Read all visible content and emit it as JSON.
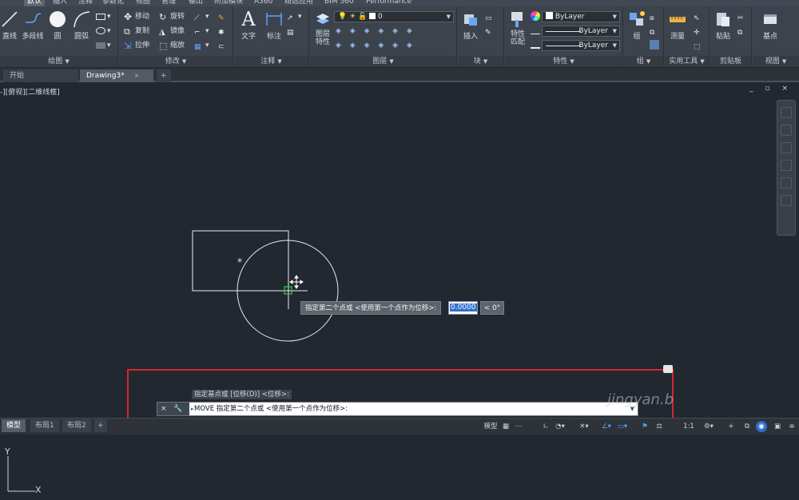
{
  "ribbon_tabs": [
    "默认",
    "插入",
    "注释",
    "参数化",
    "视图",
    "管理",
    "输出",
    "附加模块",
    "A360",
    "精选应用",
    "BIM 360",
    "Performance"
  ],
  "panels": {
    "draw": {
      "title": "绘图",
      "tools": [
        "直线",
        "多段线",
        "圆",
        "圆弧"
      ]
    },
    "modify": {
      "title": "修改",
      "tools": [
        "移动",
        "旋转",
        "复制",
        "镜像",
        "拉伸",
        "缩放"
      ]
    },
    "annotation": {
      "title": "注释",
      "tools": [
        "文字",
        "标注"
      ]
    },
    "layers": {
      "title": "图层",
      "tools": [
        "图层\n特性"
      ],
      "current_layer": "0"
    },
    "block": {
      "title": "块",
      "tools": [
        "插入"
      ]
    },
    "properties": {
      "title": "特性",
      "tools": [
        "特性\n匹配"
      ],
      "color": "ByLayer",
      "linetype": "ByLayer",
      "lineweight": "ByLayer"
    },
    "groups": {
      "title": "组",
      "tools": [
        "组"
      ]
    },
    "utilities": {
      "title": "实用工具",
      "tools": [
        "测量"
      ]
    },
    "clipboard": {
      "title": "剪贴板",
      "tools": [
        "粘贴"
      ]
    },
    "view": {
      "title": "视图",
      "tools": [
        "基点"
      ]
    }
  },
  "doc_tabs": [
    {
      "label": "开始"
    },
    {
      "label": "Drawing3*",
      "close": "×"
    },
    {
      "label": "+"
    }
  ],
  "viewport": {
    "label": "-][俯视][二维线框]",
    "controls": "_ ▫ ×"
  },
  "dynamic_input": {
    "prompt": "指定第二个点或 <使用第一个点作为位移>:",
    "value": "0.0000",
    "angle": "< 0°"
  },
  "command": {
    "history": "指定基点或 [位移(D)] <位移>:",
    "current": "MOVE 指定第二个点或 <使用第一个点作为位移>:",
    "tools": "× 🔧"
  },
  "layout_tabs": [
    "模型",
    "布局1",
    "布局2",
    "+"
  ],
  "status": {
    "model": "模型",
    "scale": "1:1"
  },
  "ucs": {
    "x": "X",
    "y": "Y"
  },
  "watermark": "jingyan.b"
}
